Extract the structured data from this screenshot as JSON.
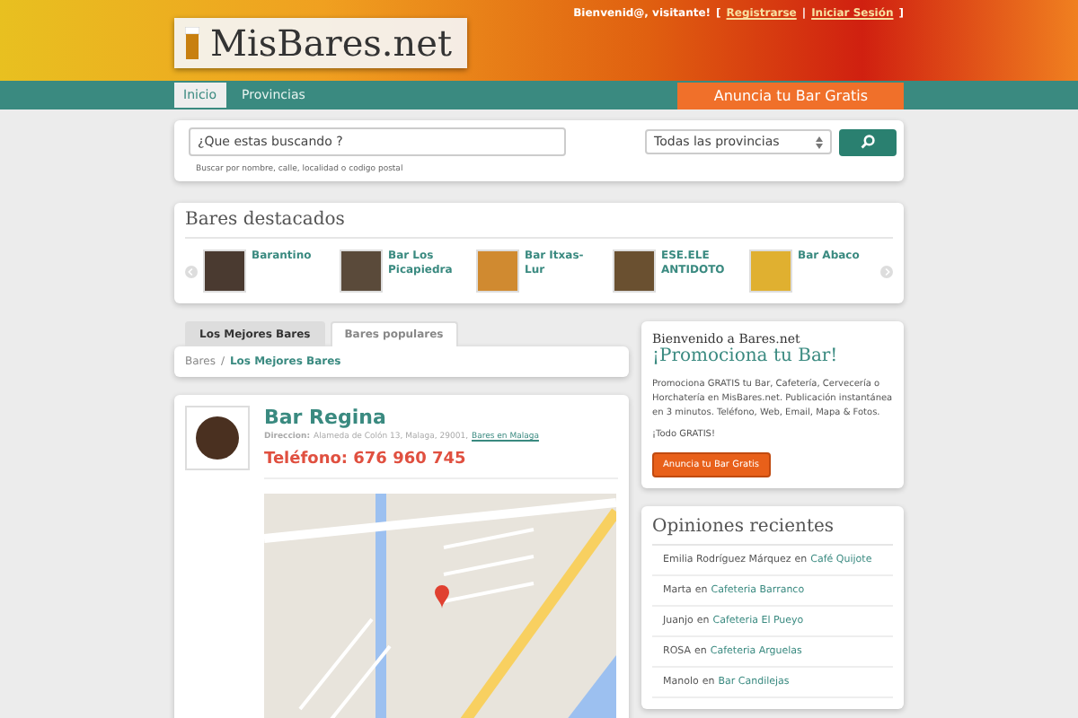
{
  "header": {
    "logo": "MisBares.net",
    "greeting": "Bienvenid@, visitante!",
    "bracket_open": "[",
    "register": "Registrarse",
    "separator": "|",
    "login": "Iniciar Sesión",
    "bracket_close": "]"
  },
  "nav": {
    "items": [
      {
        "label": "Inicio",
        "selected": true
      },
      {
        "label": "Provincias",
        "selected": false
      }
    ],
    "cta": "Anuncia tu Bar Gratis"
  },
  "search": {
    "placeholder": "¿Que estas buscando ?",
    "hint": "Buscar por nombre, calle, localidad o codigo postal",
    "province": "Todas las provincias"
  },
  "featured": {
    "title": "Bares destacados",
    "items": [
      {
        "name": "Barantino",
        "color": "#4a3a30"
      },
      {
        "name": "Bar Los Picapiedra",
        "color": "#5a4a3a"
      },
      {
        "name": "Bar Itxas-Lur",
        "color": "#d08a30"
      },
      {
        "name": "ESE.ELE ANTIDOTO",
        "color": "#6a5030"
      },
      {
        "name": "Bar Abaco",
        "color": "#e0b030"
      }
    ]
  },
  "tabs": [
    {
      "label": "Los Mejores Bares",
      "selected": true
    },
    {
      "label": "Bares populares",
      "selected": false
    }
  ],
  "breadcrumb": {
    "root": "Bares",
    "separator": "/",
    "current": "Los Mejores Bares"
  },
  "bar": {
    "name": "Bar Regina",
    "address_label": "Direccion:",
    "address": "Alameda de Colón 13, Malaga, 29001,",
    "city_link": "Bares en Malaga",
    "phone": "Teléfono: 676 960 745"
  },
  "promo": {
    "kicker": "Bienvenido a Bares.net",
    "title": "¡Promociona tu Bar!",
    "text": "Promociona GRATIS tu Bar, Cafetería, Cervecería o Horchatería en MisBares.net. Publicación instantánea en 3 minutos. Teléfono, Web, Email, Mapa & Fotos.",
    "free": "¡Todo GRATIS!",
    "button": "Anuncia tu Bar Gratis"
  },
  "reviews": {
    "title": "Opiniones recientes",
    "items": [
      {
        "author": "Emilia Rodríguez Márquez",
        "joiner": "en",
        "bar": "Café Quijote"
      },
      {
        "author": "Marta",
        "joiner": "en",
        "bar": "Cafeteria Barranco"
      },
      {
        "author": "Juanjo",
        "joiner": "en",
        "bar": "Cafeteria El Pueyo"
      },
      {
        "author": "ROSA",
        "joiner": "en",
        "bar": "Cafeteria Arguelas"
      },
      {
        "author": "Manolo",
        "joiner": "en",
        "bar": "Bar Candilejas"
      }
    ]
  }
}
